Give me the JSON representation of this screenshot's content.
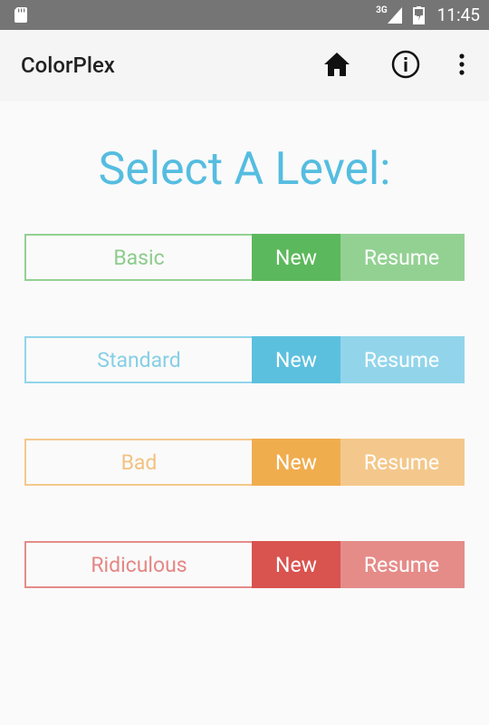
{
  "status_bar": {
    "network": "3G",
    "time": "11:45"
  },
  "app_bar": {
    "title": "ColorPlex",
    "icons": [
      "home-icon",
      "info-icon",
      "more-vert-icon"
    ]
  },
  "heading": "Select A Level:",
  "levels": [
    {
      "name": "Basic",
      "new_label": "New",
      "resume_label": "Resume",
      "color": "#5cb85c",
      "light_color": "#93d193",
      "text_color": "#8ccc8c"
    },
    {
      "name": "Standard",
      "new_label": "New",
      "resume_label": "Resume",
      "color": "#5bc0de",
      "light_color": "#92d5eb",
      "text_color": "#86cfe6"
    },
    {
      "name": "Bad",
      "new_label": "New",
      "resume_label": "Resume",
      "color": "#f0ad4e",
      "light_color": "#f4c88c",
      "text_color": "#f2c282"
    },
    {
      "name": "Ridiculous",
      "new_label": "New",
      "resume_label": "Resume",
      "color": "#d9534f",
      "light_color": "#e58c89",
      "text_color": "#e48784"
    }
  ]
}
